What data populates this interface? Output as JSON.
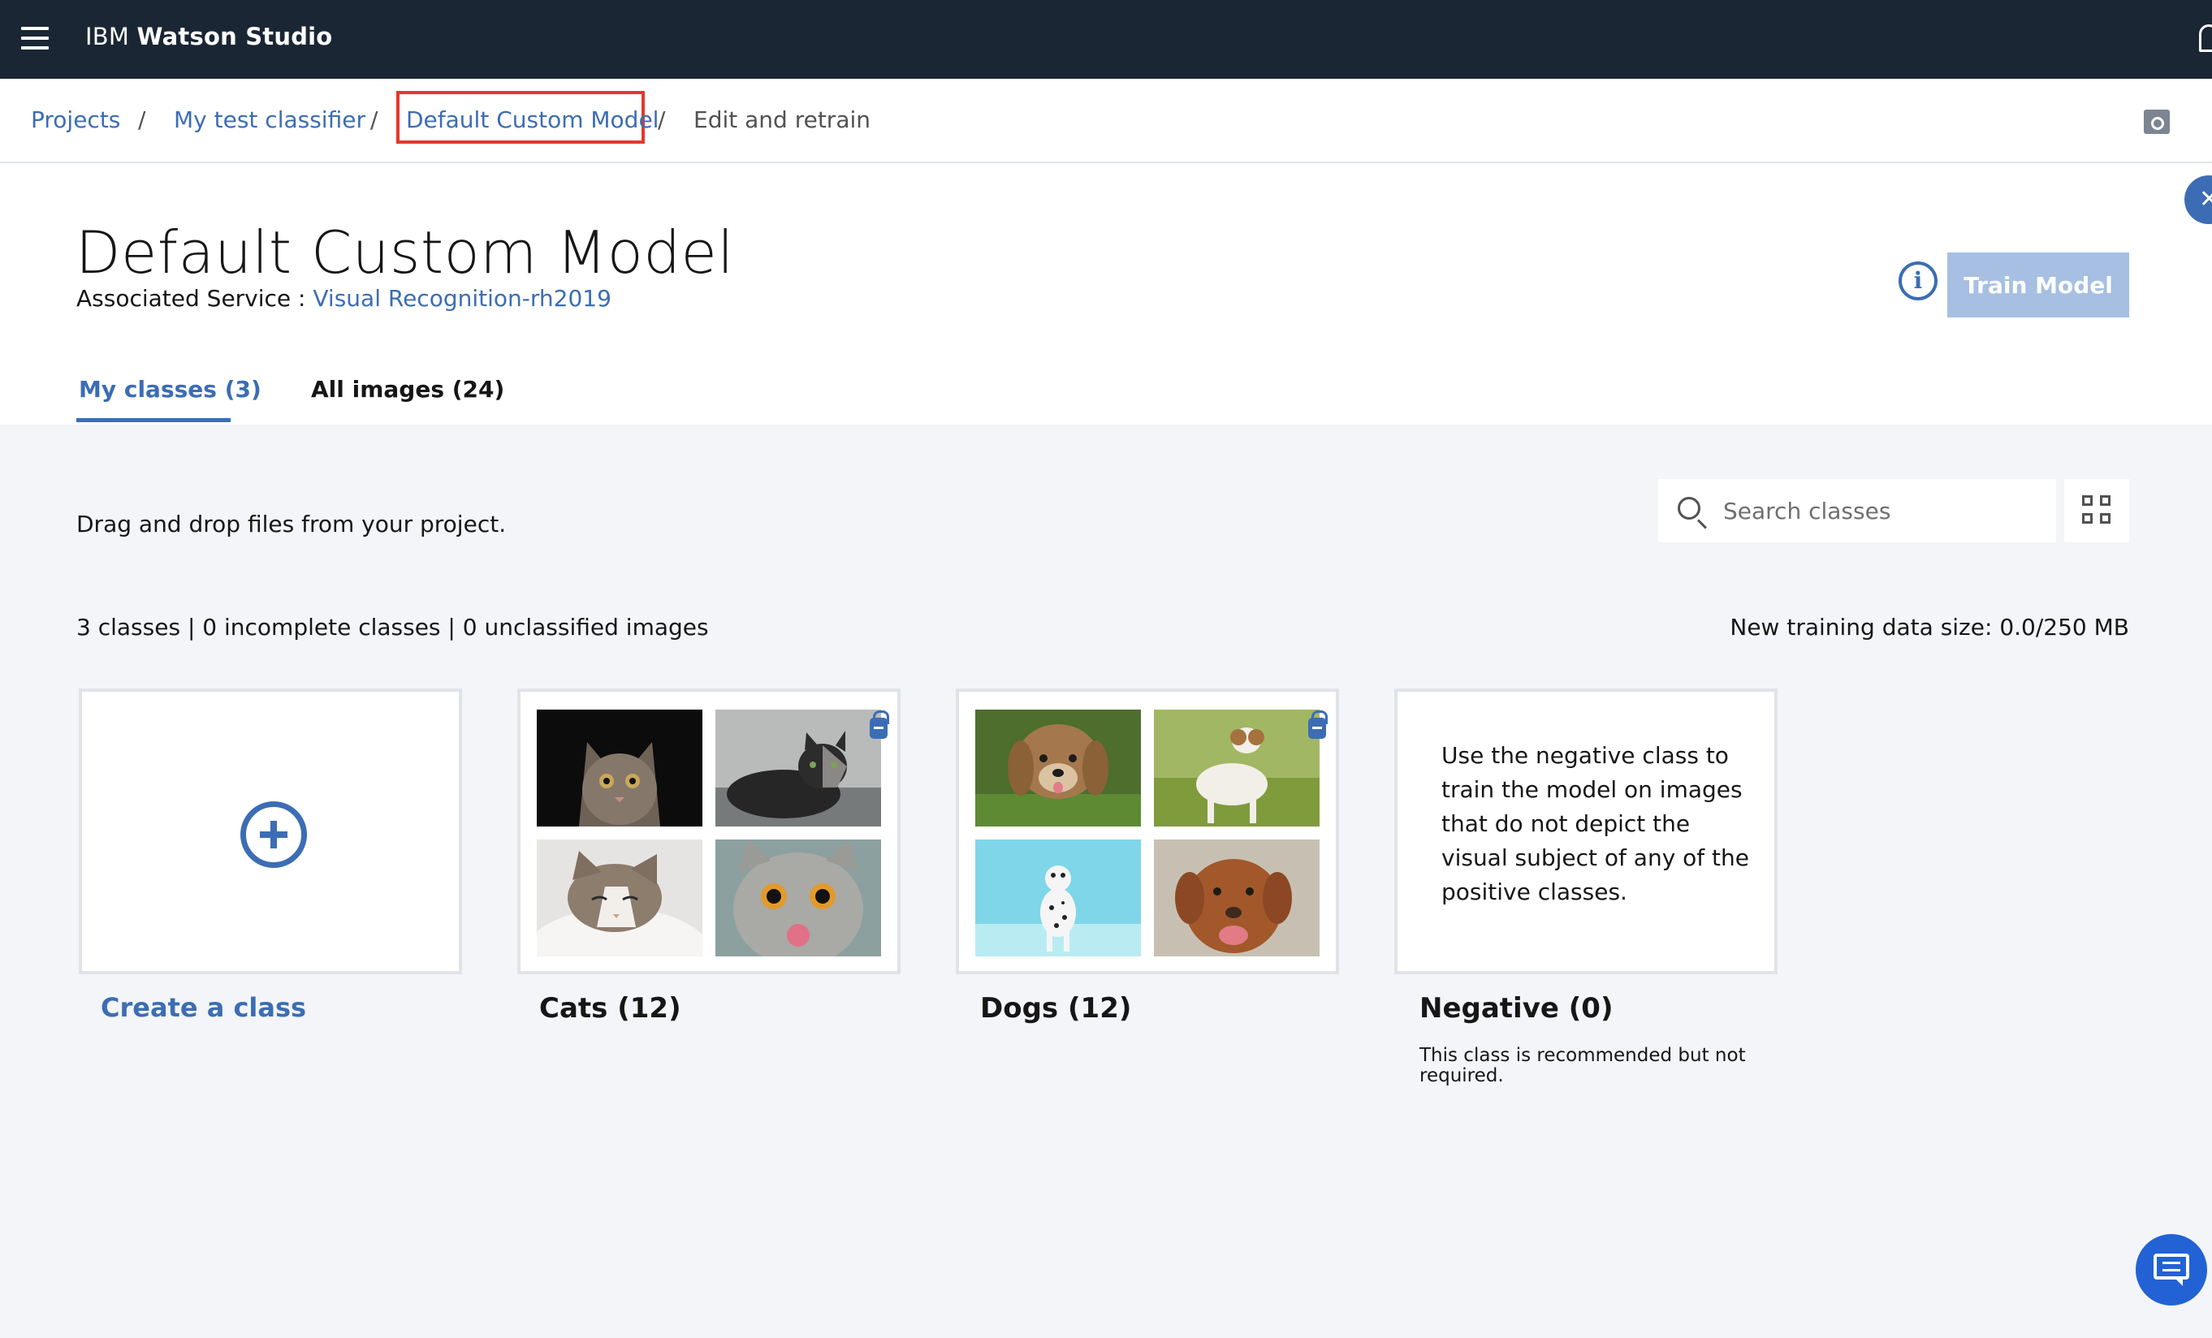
{
  "app": {
    "brand_prefix": "IBM",
    "brand_name": "Watson Studio"
  },
  "breadcrumb": {
    "items": [
      "Projects",
      "My test classifier",
      "Default Custom Model",
      "Edit and retrain"
    ],
    "separator": "/"
  },
  "header": {
    "title": "Default Custom Model",
    "assoc_label": "Associated Service : ",
    "assoc_service": "Visual Recognition-rh2019",
    "info_icon": "i",
    "train_button": "Train Model",
    "close_icon": "✕"
  },
  "tabs": [
    {
      "label": "My classes (3)",
      "active": true
    },
    {
      "label": "All images (24)",
      "active": false
    }
  ],
  "content": {
    "drag_text": "Drag and drop files from your project.",
    "search_placeholder": "Search classes",
    "counts": "3 classes | 0 incomplete classes | 0 unclassified images",
    "data_size": "New training data size: 0.0/250 MB"
  },
  "classes": {
    "create_label": "Create a class",
    "cats_label": "Cats (12)",
    "dogs_label": "Dogs (12)",
    "negative_label": "Negative (0)",
    "negative_description": "Use the negative class to train the model on images that do not depict the visual subject of any of the positive classes.",
    "negative_note": "This class is recommended but not required."
  },
  "colors": {
    "topbar": "#1a2633",
    "accent": "#3c6db4",
    "train_button_disabled": "#a6bfe2",
    "highlight_box": "#e5372c",
    "chat_button": "#2262d5"
  },
  "icons": {
    "menu": "hamburger-menu-icon",
    "notification": "bell-icon",
    "camera": "camera-icon",
    "info": "info-icon",
    "search": "search-icon",
    "grid": "grid-view-icon",
    "create": "plus-circle-icon",
    "lock": "lock-icon",
    "chat": "chat-icon"
  }
}
